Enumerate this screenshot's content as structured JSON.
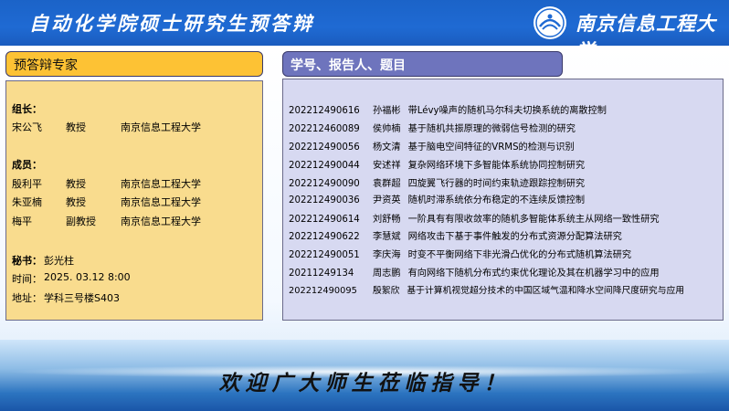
{
  "header": {
    "title": "自动化学院硕士研究生预答辩",
    "university": "南京信息工程大学"
  },
  "experts": {
    "box_title": "预答辩专家",
    "leader_label": "组长：",
    "leader": {
      "name": "宋公飞",
      "title": "教授",
      "org": "南京信息工程大学"
    },
    "members_label": "成员：",
    "members": [
      {
        "name": "殷利平",
        "title": "教授",
        "org": "南京信息工程大学"
      },
      {
        "name": "朱亚楠",
        "title": "教授",
        "org": "南京信息工程大学"
      },
      {
        "name": "梅平",
        "title": "副教授",
        "org": "南京信息工程大学"
      }
    ],
    "secretary_label": "秘书：",
    "secretary": "彭光柱",
    "time_label": "时间：",
    "time": "2025. 03.12  8:00",
    "place_label": "地址：",
    "place": "学科三号楼S403"
  },
  "students": {
    "box_title": "学号、报告人、题目",
    "rows": [
      {
        "id": "202212490616",
        "name": "孙福彬",
        "topic": "带Lévy噪声的随机马尔科夫切换系统的离散控制"
      },
      {
        "id": "202212460089",
        "name": "侯帅楠",
        "topic": "基于随机共振原理的微弱信号检测的研究"
      },
      {
        "id": "202212490056",
        "name": "杨文清",
        "topic": "基于脑电空间特征的VRMS的检测与识别"
      },
      {
        "id": "202212490044",
        "name": "安述祥",
        "topic": "复杂网络环境下多智能体系统协同控制研究"
      },
      {
        "id": "202212490090",
        "name": "袁群超",
        "topic": "四旋翼飞行器的时间约束轨迹跟踪控制研究"
      },
      {
        "id": "202212490036",
        "name": "尹资英",
        "topic": "随机时滞系统依分布稳定的不连续反馈控制"
      },
      {
        "id": "202212490614",
        "name": "刘舒畅",
        "topic": "一阶具有有限收敛率的随机多智能体系统主从网络一致性研究"
      },
      {
        "id": "202212490622",
        "name": "李慧斌",
        "topic": "网络攻击下基于事件触发的分布式资源分配算法研究"
      },
      {
        "id": "202212490051",
        "name": "李庆海",
        "topic": "时变不平衡网络下非光滑凸优化的分布式随机算法研究"
      },
      {
        "id": "20211249134",
        "name": "周志鹏",
        "topic": "有向网络下随机分布式约束优化理论及其在机器学习中的应用"
      },
      {
        "id": "202212490095",
        "name": "殷絮欣",
        "topic": "基于计算机视觉超分技术的中国区域气温和降水空间降尺度研究与应用"
      }
    ]
  },
  "footer": {
    "welcome": "欢迎广大师生莅临指导！"
  },
  "colors": {
    "header_blue": "#1f6ad3",
    "expert_title_bg": "#fdc234",
    "expert_panel_bg": "#f9dc8e",
    "student_title_bg": "#6e74bd",
    "student_panel_bg": "#d7d9f1"
  }
}
